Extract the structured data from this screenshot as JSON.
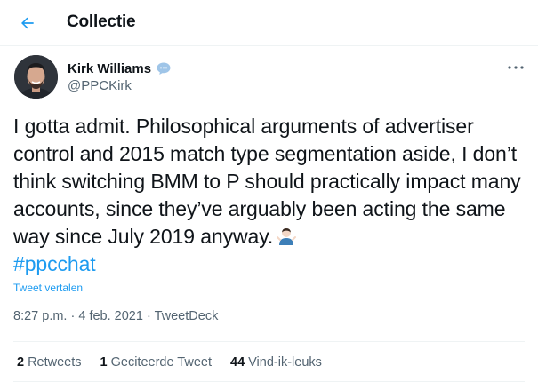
{
  "header": {
    "title": "Collectie",
    "back_icon": "arrow-left-icon"
  },
  "author": {
    "name": "Kirk Williams",
    "handle": "@PPCKirk",
    "badge_icon": "speech-bubble-icon"
  },
  "tweet": {
    "text": "I gotta admit. Philosophical arguments of advertiser control and 2015 match type segmentation aside, I don’t think switching BMM to P should practically impact many accounts, since they’ve arguably been acting the same way since July 2019 anyway.",
    "emoji": "man-shrugging-emoji",
    "hashtag": "#ppcchat",
    "translate_label": "Tweet vertalen",
    "time": "8:27 p.m.",
    "date": "4 feb. 2021",
    "source": "TweetDeck",
    "separator": "·"
  },
  "stats": {
    "retweets_count": "2",
    "retweets_label": "Retweets",
    "quotes_count": "1",
    "quotes_label": "Geciteerde Tweet",
    "likes_count": "44",
    "likes_label": "Vind-ik-leuks"
  },
  "colors": {
    "accent": "#1d9bf0",
    "text": "#0f1419",
    "muted": "#536471"
  }
}
